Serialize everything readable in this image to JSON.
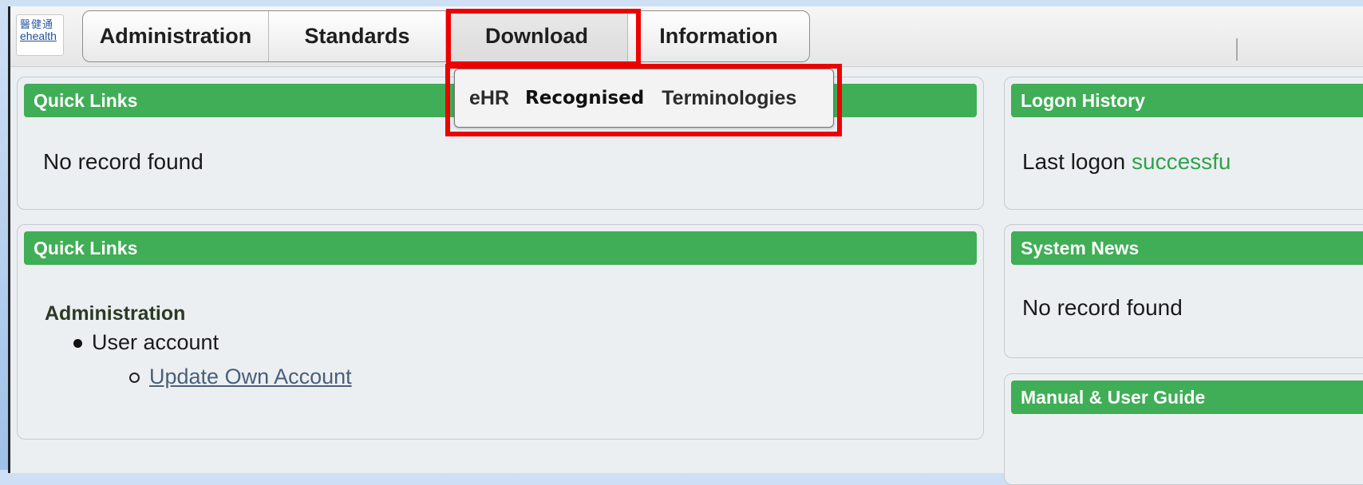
{
  "logo": {
    "zh": "醫健通",
    "en": "ehealth"
  },
  "menu": {
    "items": [
      "Administration",
      "Standards",
      "Download",
      "Information"
    ]
  },
  "dropdown": {
    "word1": "eHR",
    "word2": "Recognised",
    "word3": "Terminologies"
  },
  "panels": {
    "quick_links_1": {
      "title": "Quick Links",
      "body": "No record found"
    },
    "quick_links_2": {
      "title": "Quick Links",
      "section": "Administration",
      "item": "User account",
      "subitem": "Update Own Account"
    },
    "logon_history": {
      "title": "Logon History",
      "body_prefix": "Last logon ",
      "body_status": "successfu"
    },
    "system_news": {
      "title": "System News",
      "body": "No record found"
    },
    "manual": {
      "title": "Manual & User Guide"
    }
  },
  "colors": {
    "header_green": "#3fae56",
    "highlight_red": "#ee0000",
    "success_green": "#2fa34a"
  }
}
